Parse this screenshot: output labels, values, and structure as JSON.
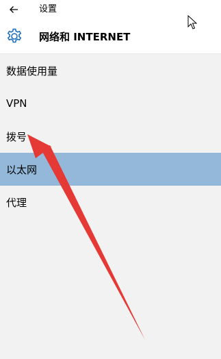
{
  "titlebar": {
    "back_icon": "back-arrow-icon",
    "title": "设置"
  },
  "header": {
    "icon": "gear-icon",
    "title": "网络和 INTERNET",
    "accent_color": "#1e6fbf"
  },
  "nav": {
    "items": [
      {
        "label": "数据使用量"
      },
      {
        "label": "VPN"
      },
      {
        "label": "拨号"
      },
      {
        "label": "以太网",
        "selected": true
      },
      {
        "label": "代理"
      }
    ],
    "selected_color": "#93b8da"
  },
  "annotation": {
    "icon": "red-arrow-pointing-to-dialup",
    "color": "#e53935"
  }
}
